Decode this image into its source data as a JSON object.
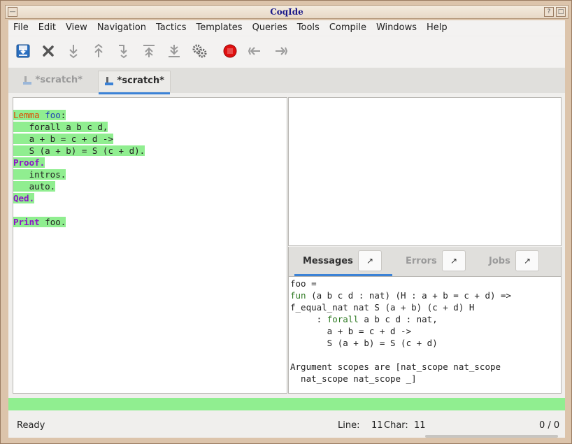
{
  "window": {
    "title": "CoqIde",
    "button_min": "—",
    "button_help": "?",
    "button_max": "□"
  },
  "menubar": [
    "File",
    "Edit",
    "View",
    "Navigation",
    "Tactics",
    "Templates",
    "Queries",
    "Tools",
    "Compile",
    "Windows",
    "Help"
  ],
  "toolbar": {
    "icons": [
      "save-icon",
      "close-icon",
      "forward-one-icon",
      "backward-one-icon",
      "go-to-cursor-icon",
      "backward-to-start-icon",
      "forward-to-end-icon",
      "run-queries-icon",
      "interrupt-icon",
      "previous-occurrence-icon",
      "next-occurrence-icon"
    ],
    "accent_blue": "#1f5fa8",
    "interrupt_red": "#e01010"
  },
  "tabs": [
    {
      "label": "*scratch*",
      "active": false
    },
    {
      "label": "*scratch*",
      "active": true
    }
  ],
  "script": {
    "lines": [
      {
        "parts": [
          {
            "t": "Lemma",
            "c": "kw-red"
          },
          {
            "t": " "
          },
          {
            "t": "foo",
            "c": "kw-blue"
          },
          {
            "t": ":"
          }
        ]
      },
      {
        "parts": [
          {
            "t": "   forall a b c d,"
          }
        ]
      },
      {
        "parts": [
          {
            "t": "   a + b = c + d ->"
          }
        ]
      },
      {
        "parts": [
          {
            "t": "   S (a + b) = S (c + d)."
          }
        ]
      },
      {
        "parts": [
          {
            "t": "Proof.",
            "c": "kw-purple"
          }
        ]
      },
      {
        "parts": [
          {
            "t": "   intros."
          }
        ]
      },
      {
        "parts": [
          {
            "t": "   auto."
          }
        ]
      },
      {
        "parts": [
          {
            "t": "Qed.",
            "c": "kw-purple"
          }
        ]
      },
      {
        "parts": []
      },
      {
        "parts": [
          {
            "t": "Print",
            "c": "kw-purple"
          },
          {
            "t": " foo."
          }
        ]
      }
    ],
    "highlight_color": "#90ee90"
  },
  "message_tabs": {
    "messages": "Messages",
    "errors": "Errors",
    "jobs": "Jobs",
    "detach_glyph": "↗"
  },
  "messages": {
    "lines": [
      {
        "parts": [
          {
            "t": "foo ="
          }
        ]
      },
      {
        "parts": [
          {
            "t": "fun",
            "c": "kw-green"
          },
          {
            "t": " (a b c d : nat) (H : a + b = c + d) =>"
          }
        ]
      },
      {
        "parts": [
          {
            "t": "f_equal_nat nat S (a + b) (c + d) H"
          }
        ]
      },
      {
        "parts": [
          {
            "t": "     : "
          },
          {
            "t": "forall",
            "c": "kw-green"
          },
          {
            "t": " a b c d : nat,"
          }
        ]
      },
      {
        "parts": [
          {
            "t": "       a + b = c + d ->"
          }
        ]
      },
      {
        "parts": [
          {
            "t": "       S (a + b) = S (c + d)"
          }
        ]
      },
      {
        "parts": []
      },
      {
        "parts": [
          {
            "t": "Argument scopes are [nat_scope nat_scope"
          }
        ]
      },
      {
        "parts": [
          {
            "t": "  nat_scope nat_scope _]"
          }
        ]
      }
    ]
  },
  "status": {
    "ready": "Ready",
    "line_label": "Line:",
    "line_value": "11",
    "char_label": "Char:",
    "char_value": "11",
    "counter": "0 / 0"
  }
}
